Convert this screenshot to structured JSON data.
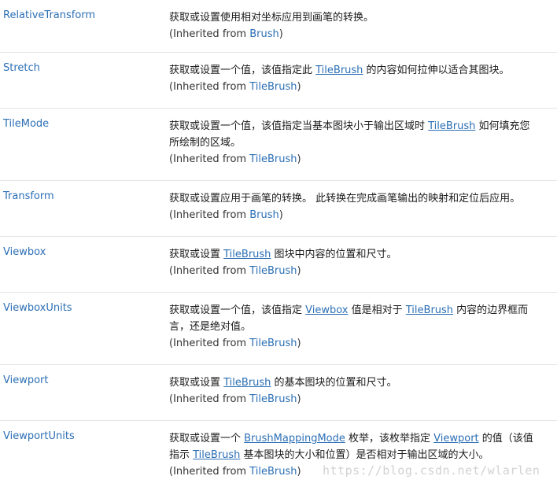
{
  "inherited_prefix": "(Inherited from ",
  "inherited_suffix": ")",
  "properties": [
    {
      "name": "RelativeTransform",
      "lines": [
        [
          "获取或设置使用相对坐标应用到画笔的转换。"
        ]
      ],
      "inherited_from": "Brush"
    },
    {
      "name": "Stretch",
      "lines": [
        [
          "获取或设置一个值，该值指定此 ",
          {
            "link": "TileBrush"
          },
          " 的内容如何拉伸以适合其图块。"
        ]
      ],
      "inherited_from": "TileBrush"
    },
    {
      "name": "TileMode",
      "lines": [
        [
          "获取或设置一个值，该值指定当基本图块小于输出区域时 ",
          {
            "link": "TileBrush"
          },
          " 如何填充您"
        ],
        [
          "所绘制的区域。"
        ]
      ],
      "inherited_from": "TileBrush"
    },
    {
      "name": "Transform",
      "lines": [
        [
          "获取或设置应用于画笔的转换。 此转换在完成画笔输出的映射和定位后应用。"
        ]
      ],
      "inherited_from": "Brush"
    },
    {
      "name": "Viewbox",
      "lines": [
        [
          "获取或设置 ",
          {
            "link": "TileBrush"
          },
          " 图块中内容的位置和尺寸。"
        ]
      ],
      "inherited_from": "TileBrush"
    },
    {
      "name": "ViewboxUnits",
      "lines": [
        [
          "获取或设置一个值，该值指定 ",
          {
            "link": "Viewbox"
          },
          " 值是相对于 ",
          {
            "link": "TileBrush"
          },
          " 内容的边界框而"
        ],
        [
          "言，还是绝对值。"
        ]
      ],
      "inherited_from": "TileBrush"
    },
    {
      "name": "Viewport",
      "lines": [
        [
          "获取或设置 ",
          {
            "link": "TileBrush"
          },
          " 的基本图块的位置和尺寸。"
        ]
      ],
      "inherited_from": "TileBrush"
    },
    {
      "name": "ViewportUnits",
      "lines": [
        [
          "获取或设置一个 ",
          {
            "link": "BrushMappingMode"
          },
          " 枚举，该枚举指定 ",
          {
            "link": "Viewport"
          },
          " 的值（该值"
        ],
        [
          "指示 ",
          {
            "link": "TileBrush"
          },
          " 基本图块的大小和位置）是否相对于输出区域的大小。"
        ]
      ],
      "inherited_from": "TileBrush"
    }
  ],
  "watermark": "https://blog.csdn.net/wlarlen"
}
